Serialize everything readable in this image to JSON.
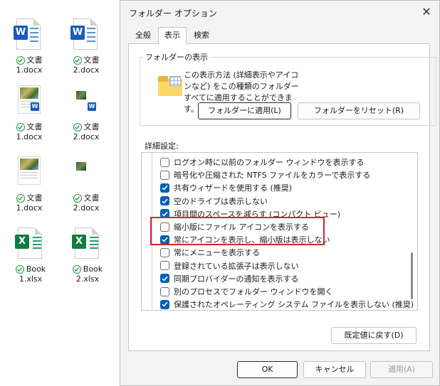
{
  "desktop": {
    "icons": [
      {
        "line1": "文書",
        "line2": "1.docx"
      },
      {
        "line1": "文書",
        "line2": "2.docx"
      },
      {
        "line1": "文書",
        "line2": "1.docx"
      },
      {
        "line1": "文書",
        "line2": "2.docx"
      },
      {
        "line1": "文書",
        "line2": "1.docx"
      },
      {
        "line1": "文書",
        "line2": "2.docx"
      },
      {
        "line1": "Book",
        "line2": "1.xlsx"
      },
      {
        "line1": "Book",
        "line2": "2.xlsx"
      }
    ],
    "word_letter": "W",
    "excel_letter": "X"
  },
  "dialog": {
    "title": "フォルダー オプション",
    "close": "✕",
    "tabs": [
      "全般",
      "表示",
      "検索"
    ],
    "active_tab": "表示",
    "folder_view": {
      "title": "フォルダーの表示",
      "description": "この表示方法 (詳細表示やアイコンなど) をこの種類のフォルダーすべてに適用することができます。",
      "apply_button": "フォルダーに適用(L)",
      "reset_button": "フォルダーをリセット(R)"
    },
    "advanced_label": "詳細設定:",
    "settings": [
      {
        "label": "ログオン時に以前のフォルダー ウィンドウを表示する",
        "checked": false
      },
      {
        "label": "暗号化や圧縮された NTFS ファイルをカラーで表示する",
        "checked": false
      },
      {
        "label": "共有ウィザードを使用する (推奨)",
        "checked": true
      },
      {
        "label": "空のドライブは表示しない",
        "checked": true
      },
      {
        "label": "項目間のスペースを減らす (コンパクト ビュー)",
        "checked": true
      },
      {
        "label": "縮小版にファイル アイコンを表示する",
        "checked": false
      },
      {
        "label": "常にアイコンを表示し、縮小版は表示しない",
        "checked": true
      },
      {
        "label": "常にメニューを表示する",
        "checked": false
      },
      {
        "label": "登録されている拡張子は表示しない",
        "checked": false
      },
      {
        "label": "同期プロバイダーの通知を表示する",
        "checked": true
      },
      {
        "label": "別のプロセスでフォルダー ウィンドウを開く",
        "checked": false
      },
      {
        "label": "保護されたオペレーティング システム ファイルを表示しない (推奨)",
        "checked": true
      }
    ],
    "restore_defaults": "既定値に戻す(D)",
    "ok": "OK",
    "cancel": "キャンセル",
    "apply": "適用(A)"
  },
  "colors": {
    "accent": "#005fb8",
    "highlight": "#d6232b",
    "sync_ok": "#1f9d3a"
  }
}
